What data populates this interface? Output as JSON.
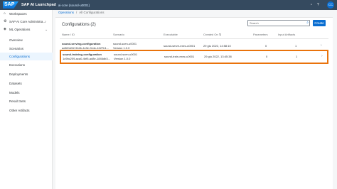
{
  "shell": {
    "brand": "SAP",
    "title": "SAP AI Launchpad",
    "subtitle": "ai-core (sound-u0001)",
    "avatar": "CC"
  },
  "sidebar": {
    "items": [
      {
        "label": "Workspaces",
        "icon": "home-icon"
      },
      {
        "label": "SAP AI Core Administra...",
        "icon": "settings-icon"
      },
      {
        "label": "ML Operations",
        "icon": "ml-icon"
      },
      {
        "label": "Overview"
      },
      {
        "label": "Scenarios"
      },
      {
        "label": "Configurations"
      },
      {
        "label": "Executions"
      },
      {
        "label": "Deployments"
      },
      {
        "label": "Datasets"
      },
      {
        "label": "Models"
      },
      {
        "label": "Result Sets"
      },
      {
        "label": "Other Artifacts"
      }
    ]
  },
  "breadcrumb": {
    "link": "Operations",
    "sep": "/",
    "current": "All Configurations"
  },
  "panel": {
    "title": "Configurations (2)",
    "search_placeholder": "Search",
    "create_label": "Create"
  },
  "table": {
    "headers": [
      "Name / ID",
      "Scenario",
      "Executable",
      "Created On",
      "Parameters",
      "Input Artifacts"
    ],
    "rows": [
      {
        "name": "sound-serving-configuration",
        "id": "ad821d52-9b2b-4c9e-9e4c-4227b1...",
        "scenario": "sound-scen-u0001",
        "version": "Version 1.0.0",
        "executable": "sound-serve-exec-u0001",
        "created": "29 giu 2022, 14:58:10",
        "parameters": "0",
        "artifacts": "1"
      },
      {
        "name": "sound-training-configuration",
        "id": "1c9bc209-aca0-4bf5-ad8e-1846db3...",
        "scenario": "sound-scen-u0001",
        "version": "Version 1.0.0",
        "executable": "sound-train-exec-u0001",
        "created": "29 giu 2022, 13:45:38",
        "parameters": "0",
        "artifacts": "1"
      }
    ]
  },
  "colors": {
    "accent": "#0a6ed1",
    "shell": "#354a5f",
    "selection": "#e9730c"
  }
}
